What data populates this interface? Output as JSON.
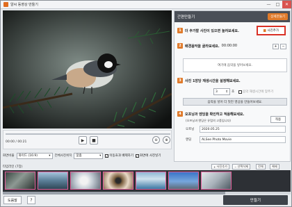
{
  "window": {
    "title": "알씨 동영상 만들기",
    "controls": [
      "—",
      "□",
      "✕"
    ]
  },
  "player": {
    "time": "00:00 / 00:21",
    "play_icon": "play-icon",
    "stop_icon": "stop-icon"
  },
  "options": {
    "resolution_label": "화면비율",
    "resolution_value": "와이드 (16:9)",
    "fit_label": "전체사진위치",
    "fit_value": "맞춤",
    "check1": "이동효과 배제하기",
    "check2": "화면에 사진넣기"
  },
  "panel": {
    "header": "간편만들기",
    "detail_button": "상세만들기",
    "step1": "더 추가할 사진이 있으면 눌러보세요.",
    "add_photo": "사진추가",
    "step2": "배경음악을 골라보세요.",
    "step2_time": "00:00:00",
    "music_placeholder": "여기에 음악을 넣어보세요.",
    "step3": "사진 1장당 재생시간을 설정해보세요.",
    "seconds_value": "3",
    "seconds_unit": "초",
    "step3_check": "음악 재생시간에 맞추기",
    "apply_button": "음악을 넣어 더 멋진 영상을 만들어보세요.",
    "step4": "오프닝과 엔딩을 확인하고 적용해보세요.",
    "step4_sub": "(오프닝과 엔딩은 유럽의 고풍입니다)",
    "apply4": "적용",
    "opening_label": "오프닝",
    "opening_value": "2020.05.25",
    "ending_label": "엔딩",
    "ending_value": "ALSee Photo Movie"
  },
  "timeline": {
    "label": "타임라인 (7장)",
    "add_button": "사진추가",
    "delete_button": "선택삭제",
    "select_all": "전체",
    "deselect": "해제",
    "thumbs": [
      "bird",
      "lake",
      "fox",
      "eye",
      "ocean",
      "city",
      "swan"
    ]
  },
  "footer": {
    "help_button": "도움말",
    "q_button": "?",
    "make_button": "만들기"
  },
  "colors": {
    "accent": "#e07a2a",
    "highlight": "#d93025",
    "thumb_border": "#e35f9a"
  }
}
